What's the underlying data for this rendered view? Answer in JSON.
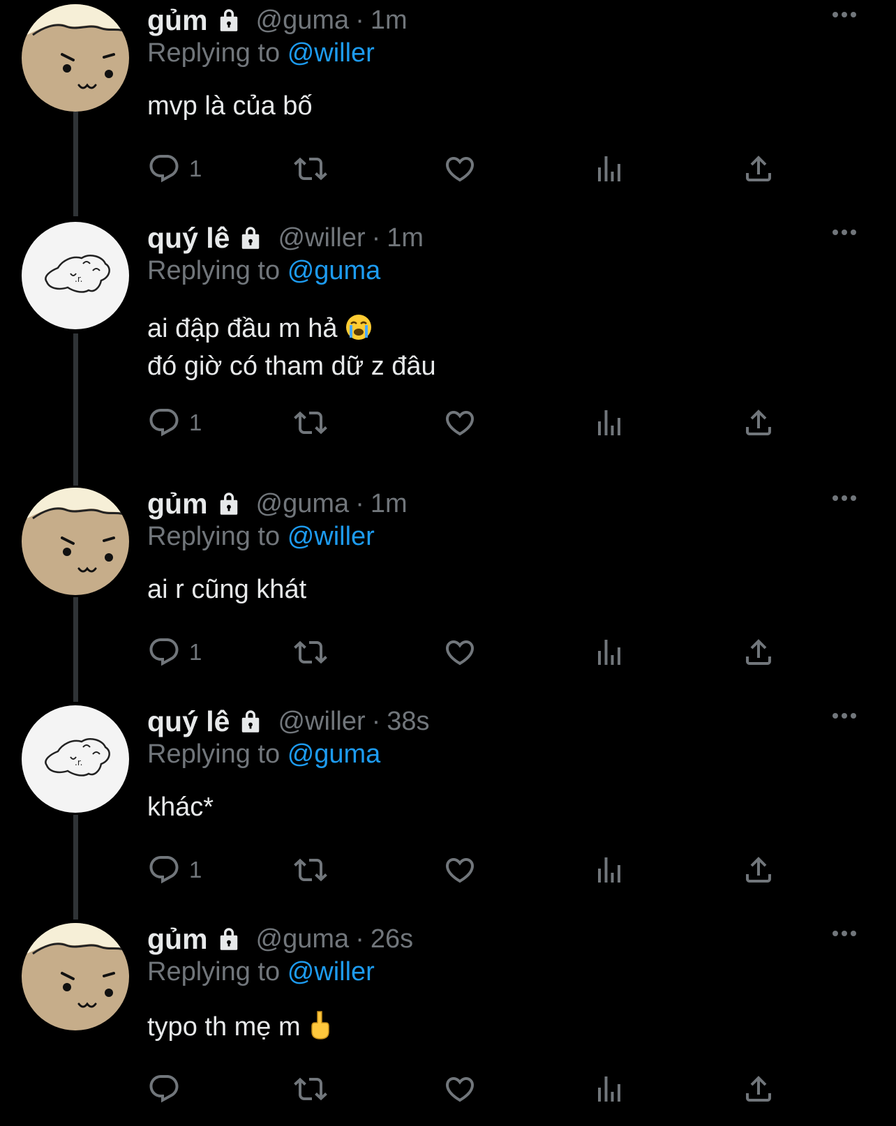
{
  "tweets": [
    {
      "display_name": "gủm",
      "handle": "@guma",
      "time": "1m",
      "replying_prefix": "Replying to",
      "replying_to": "@willer",
      "text_lines": [
        "mvp là của bố"
      ],
      "reply_count": "1",
      "avatar": "bread-face-avatar"
    },
    {
      "display_name": "quý lê",
      "handle": "@willer",
      "time": "1m",
      "replying_prefix": "Replying to",
      "replying_to": "@guma",
      "text_lines": [
        "ai đập đầu m hả",
        "đó giờ có tham dữ z đâu"
      ],
      "reply_count": "1",
      "avatar": "doodle-avatar",
      "emoji": "loudly-crying-face-emoji"
    },
    {
      "display_name": "gủm",
      "handle": "@guma",
      "time": "1m",
      "replying_prefix": "Replying to",
      "replying_to": "@willer",
      "text_lines": [
        "ai r cũng khát"
      ],
      "reply_count": "1",
      "avatar": "bread-face-avatar"
    },
    {
      "display_name": "quý lê",
      "handle": "@willer",
      "time": "38s",
      "replying_prefix": "Replying to",
      "replying_to": "@guma",
      "text_lines": [
        "khác*"
      ],
      "reply_count": "1",
      "avatar": "doodle-avatar"
    },
    {
      "display_name": "gủm",
      "handle": "@guma",
      "time": "26s",
      "replying_prefix": "Replying to",
      "replying_to": "@willer",
      "text_lines": [
        "typo th mẹ m"
      ],
      "reply_count": "",
      "avatar": "bread-face-avatar",
      "emoji": "middle-finger-emoji"
    }
  ],
  "separator": "·",
  "icons": [
    "lock-icon",
    "more-icon",
    "reply-icon",
    "retweet-icon",
    "like-icon",
    "views-icon",
    "share-icon"
  ],
  "colors": {
    "background": "#000000",
    "text": "#e7e9ea",
    "muted": "#71767b",
    "link": "#1d9bf0",
    "thread_line": "#2f3336"
  }
}
